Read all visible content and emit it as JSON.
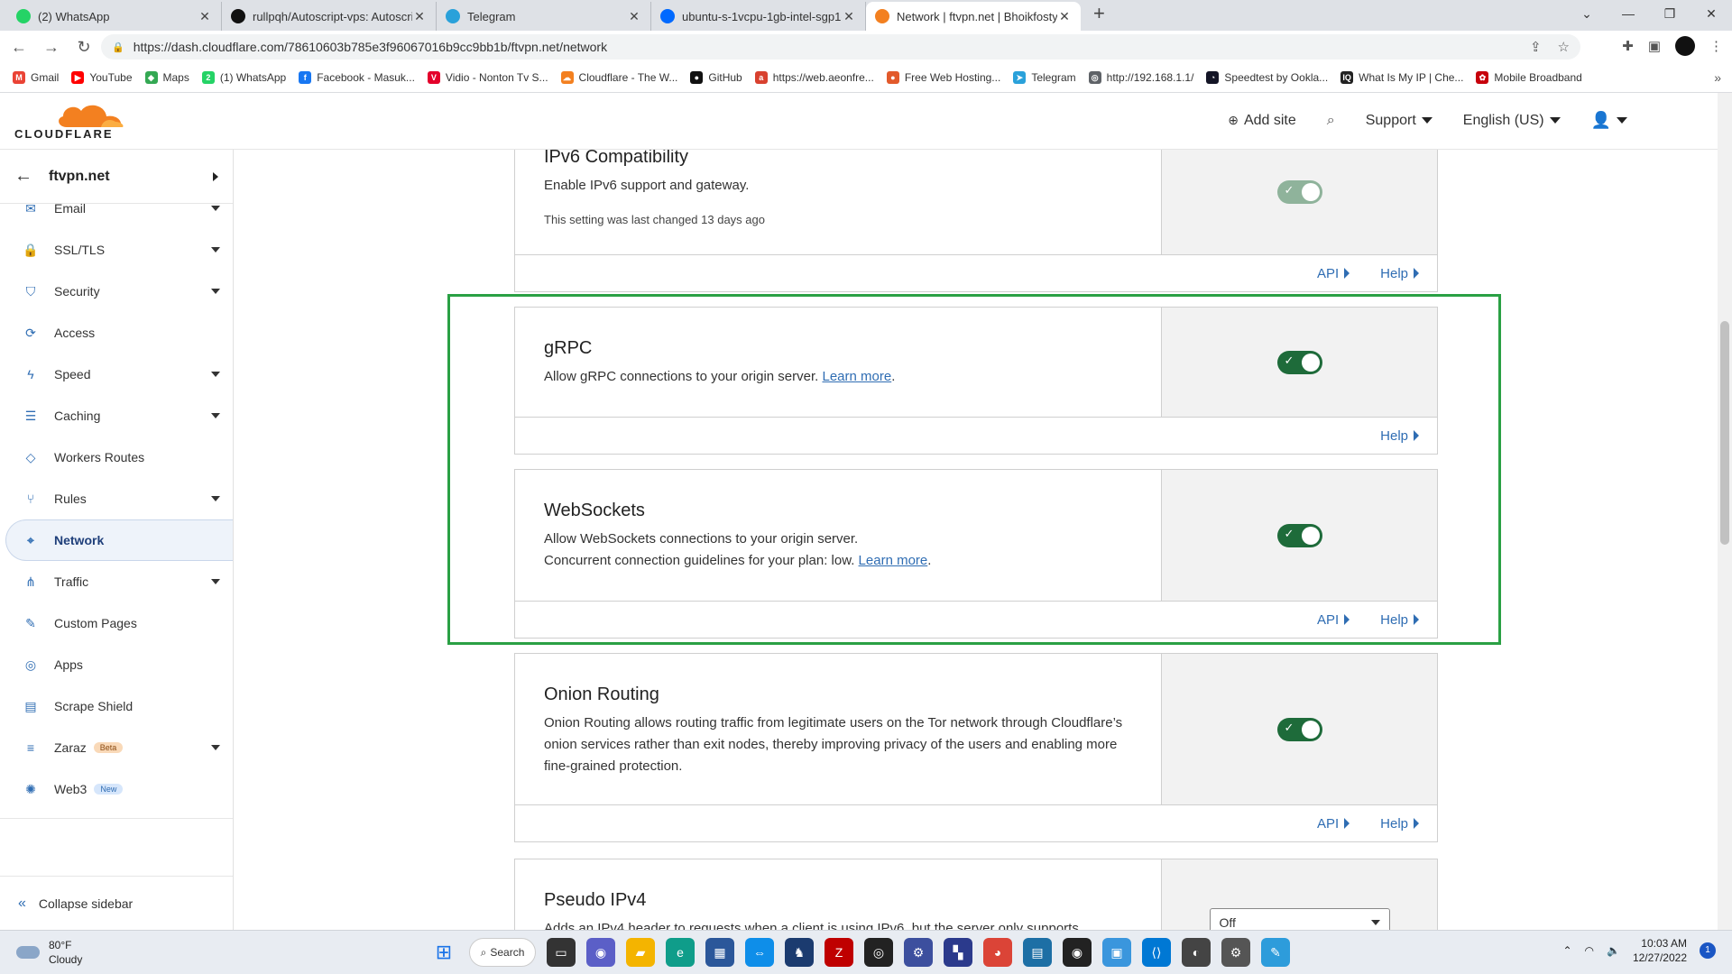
{
  "browser": {
    "tabs": [
      {
        "title": "(2) WhatsApp",
        "icon": "whatsapp-icon",
        "color": "#25d366"
      },
      {
        "title": "rullpqh/Autoscript-vps: Autoscrip",
        "icon": "github-icon",
        "color": "#111111"
      },
      {
        "title": "Telegram",
        "icon": "telegram-icon",
        "color": "#2aa1da"
      },
      {
        "title": "ubuntu-s-1vcpu-1gb-intel-sgp1-",
        "icon": "digitalocean-icon",
        "color": "#0069ff"
      },
      {
        "title": "Network | ftvpn.net | Bhoikfostya",
        "icon": "cloudflare-icon",
        "color": "#f38020"
      }
    ],
    "new_tab": "+",
    "url": "https://dash.cloudflare.com/78610603b785e3f96067016b9cc9bb1b/ftvpn.net/network",
    "bookmarks": [
      {
        "label": "Gmail",
        "color": "#ea4335",
        "glyph": "M"
      },
      {
        "label": "YouTube",
        "color": "#ff0000",
        "glyph": "▶"
      },
      {
        "label": "Maps",
        "color": "#34a853",
        "glyph": "◆"
      },
      {
        "label": "(1) WhatsApp",
        "color": "#25d366",
        "glyph": "2"
      },
      {
        "label": "Facebook - Masuk...",
        "color": "#1877f2",
        "glyph": "f"
      },
      {
        "label": "Vidio - Nonton Tv S...",
        "color": "#e4002b",
        "glyph": "V"
      },
      {
        "label": "Cloudflare - The W...",
        "color": "#f38020",
        "glyph": "☁"
      },
      {
        "label": "GitHub",
        "color": "#111111",
        "glyph": "●"
      },
      {
        "label": "https://web.aeonfre...",
        "color": "#d8412f",
        "glyph": "a"
      },
      {
        "label": "Free Web Hosting...",
        "color": "#e25a2b",
        "glyph": "●"
      },
      {
        "label": "Telegram",
        "color": "#2aa1da",
        "glyph": "➤"
      },
      {
        "label": "http://192.168.1.1/",
        "color": "#5f6368",
        "glyph": "◎"
      },
      {
        "label": "Speedtest by Ookla...",
        "color": "#141526",
        "glyph": "◔"
      },
      {
        "label": "What Is My IP | Che...",
        "color": "#222222",
        "glyph": "IQ"
      },
      {
        "label": "Mobile Broadband",
        "color": "#c7000b",
        "glyph": "✿"
      }
    ]
  },
  "header": {
    "logo_text": "CLOUDFLARE",
    "add_site": "Add site",
    "support": "Support",
    "language": "English (US)"
  },
  "sidebar": {
    "zone": "ftvpn.net",
    "items": [
      {
        "label": "Email",
        "icon": "email-icon",
        "glyph": "✉",
        "dropdown": true
      },
      {
        "label": "SSL/TLS",
        "icon": "lock-icon",
        "glyph": "🔒",
        "dropdown": true
      },
      {
        "label": "Security",
        "icon": "shield-icon",
        "glyph": "⛉",
        "dropdown": true
      },
      {
        "label": "Access",
        "icon": "access-icon",
        "glyph": "⟳",
        "dropdown": false
      },
      {
        "label": "Speed",
        "icon": "lightning-icon",
        "glyph": "ϟ",
        "dropdown": true
      },
      {
        "label": "Caching",
        "icon": "caching-icon",
        "glyph": "☰",
        "dropdown": true
      },
      {
        "label": "Workers Routes",
        "icon": "workers-icon",
        "glyph": "◇",
        "dropdown": false
      },
      {
        "label": "Rules",
        "icon": "rules-icon",
        "glyph": "⑂",
        "dropdown": true
      },
      {
        "label": "Network",
        "icon": "location-pin-icon",
        "glyph": "⌖",
        "dropdown": false,
        "active": true
      },
      {
        "label": "Traffic",
        "icon": "traffic-icon",
        "glyph": "⋔",
        "dropdown": true
      },
      {
        "label": "Custom Pages",
        "icon": "wrench-icon",
        "glyph": "✎",
        "dropdown": false
      },
      {
        "label": "Apps",
        "icon": "apps-icon",
        "glyph": "◎",
        "dropdown": false
      },
      {
        "label": "Scrape Shield",
        "icon": "document-icon",
        "glyph": "▤",
        "dropdown": false
      },
      {
        "label": "Zaraz",
        "icon": "zaraz-icon",
        "glyph": "≡",
        "dropdown": true,
        "badge": "Beta",
        "badge_bg": "#f9d9b8",
        "badge_fg": "#8a4a12"
      },
      {
        "label": "Web3",
        "icon": "web3-icon",
        "glyph": "✺",
        "dropdown": false,
        "badge": "New",
        "badge_bg": "#d6e6fb",
        "badge_fg": "#2f6db3"
      }
    ],
    "collapse": "Collapse sidebar"
  },
  "cards": {
    "ipv6": {
      "title": "IPv6 Compatibility",
      "desc": "Enable IPv6 support and gateway.",
      "meta": "This setting was last changed 13 days ago",
      "api": "API",
      "help": "Help"
    },
    "grpc": {
      "title": "gRPC",
      "desc": "Allow gRPC connections to your origin server.",
      "learn": "Learn more",
      "help": "Help"
    },
    "websockets": {
      "title": "WebSockets",
      "desc1": "Allow WebSockets connections to your origin server.",
      "desc2": "Concurrent connection guidelines for your plan: low.",
      "learn": "Learn more",
      "api": "API",
      "help": "Help"
    },
    "onion": {
      "title": "Onion Routing",
      "desc": "Onion Routing allows routing traffic from legitimate users on the Tor network through Cloudflare’s onion services rather than exit nodes, thereby improving privacy of the users and enabling more fine-grained protection.",
      "api": "API",
      "help": "Help"
    },
    "pseudo": {
      "title": "Pseudo IPv4",
      "desc": "Adds an IPv4 header to requests when a client is using IPv6, but the server only supports",
      "select": "Off"
    }
  },
  "taskbar": {
    "temp": "80°F",
    "weather": "Cloudy",
    "search": "Search",
    "time": "10:03 AM",
    "date": "12/27/2022",
    "notifications": "1"
  }
}
